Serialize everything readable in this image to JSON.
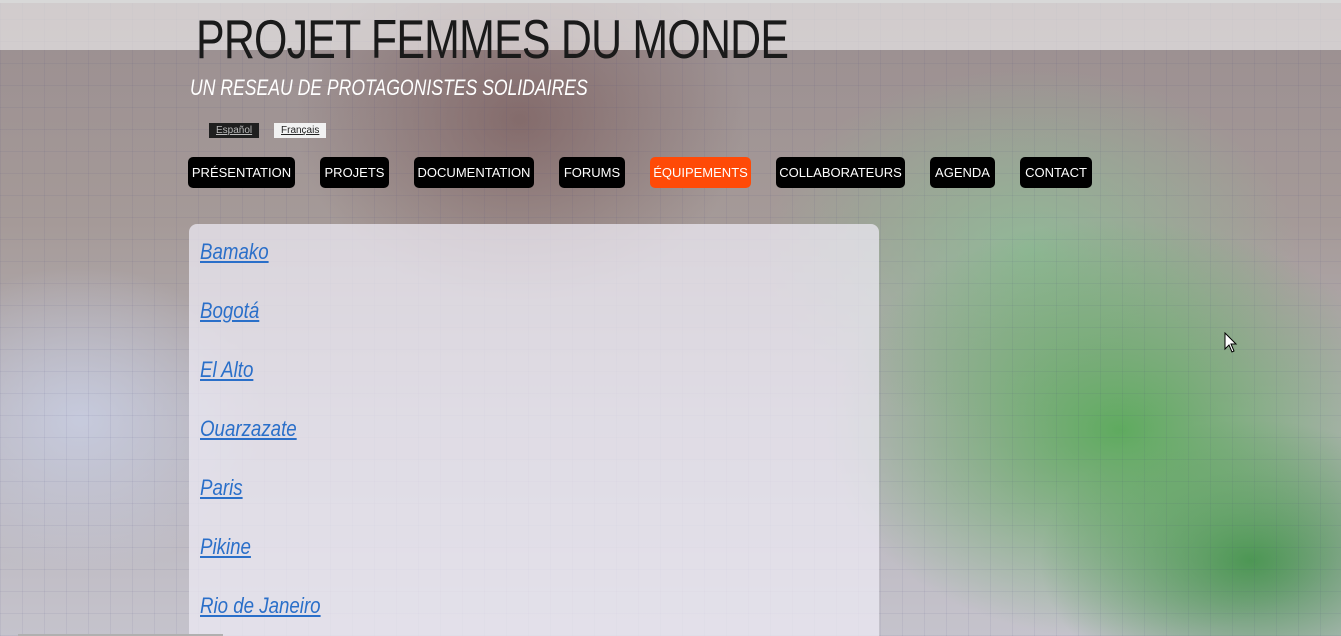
{
  "header": {
    "title": "PROJET FEMMES DU MONDE",
    "subtitle": "UN RESEAU DE PROTAGONISTES SOLIDAIRES"
  },
  "languages": {
    "es": "Español",
    "fr": "Français"
  },
  "nav": {
    "items": [
      {
        "label": "PRÉSENTATION"
      },
      {
        "label": "PROJETS"
      },
      {
        "label": "DOCUMENTATION"
      },
      {
        "label": "FORUMS"
      },
      {
        "label": "ÉQUIPEMENTS",
        "active": true
      },
      {
        "label": "COLLABORATEURS"
      },
      {
        "label": "AGENDA"
      },
      {
        "label": "CONTACT"
      }
    ],
    "active_color": "#ff4a07"
  },
  "main": {
    "cities": [
      "Bamako",
      "Bogotá",
      "El Alto",
      "Ouarzazate",
      "Paris",
      "Pikine",
      "Rio de Janeiro"
    ]
  },
  "icons": {
    "cursor": "mouse-pointer-icon"
  }
}
